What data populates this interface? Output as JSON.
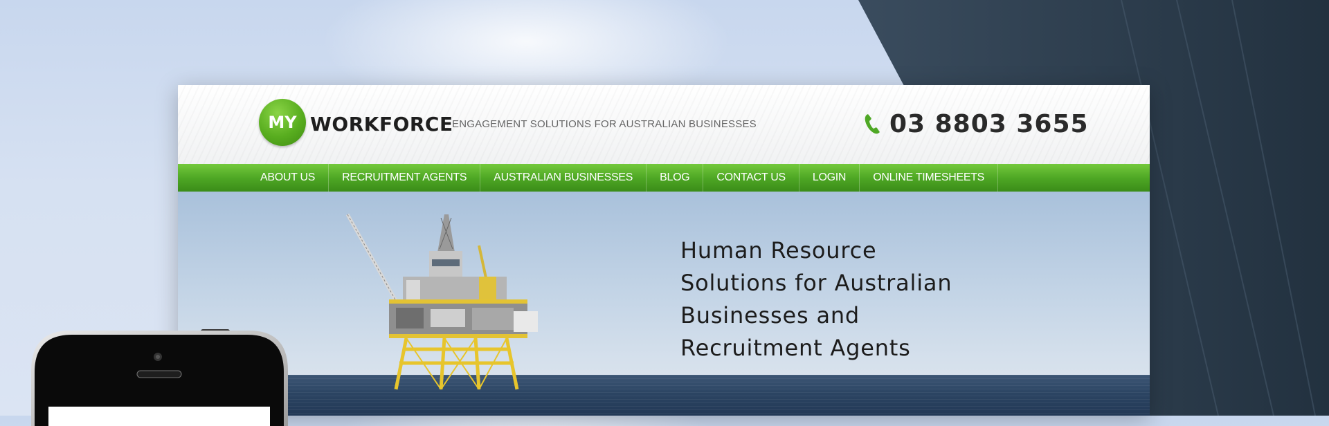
{
  "logo": {
    "badge": "MY",
    "word": "WORKFORCE"
  },
  "header": {
    "tagline": "ENGAGEMENT SOLUTIONS FOR AUSTRALIAN BUSINESSES",
    "phone": "03 8803 3655"
  },
  "nav": {
    "items": [
      {
        "label": "ABOUT US"
      },
      {
        "label": "RECRUITMENT AGENTS"
      },
      {
        "label": "AUSTRALIAN BUSINESSES"
      },
      {
        "label": "BLOG"
      },
      {
        "label": "CONTACT US"
      },
      {
        "label": "LOGIN"
      },
      {
        "label": "ONLINE TIMESHEETS"
      }
    ]
  },
  "hero": {
    "lines": [
      "Human Resource",
      "Solutions for Australian",
      "Businesses and",
      "Recruitment Agents"
    ]
  },
  "colors": {
    "brand_green": "#4fa825",
    "text_dark": "#1c1c1c"
  },
  "icons": {
    "phone": "phone-icon",
    "rig": "oil-rig-image"
  }
}
